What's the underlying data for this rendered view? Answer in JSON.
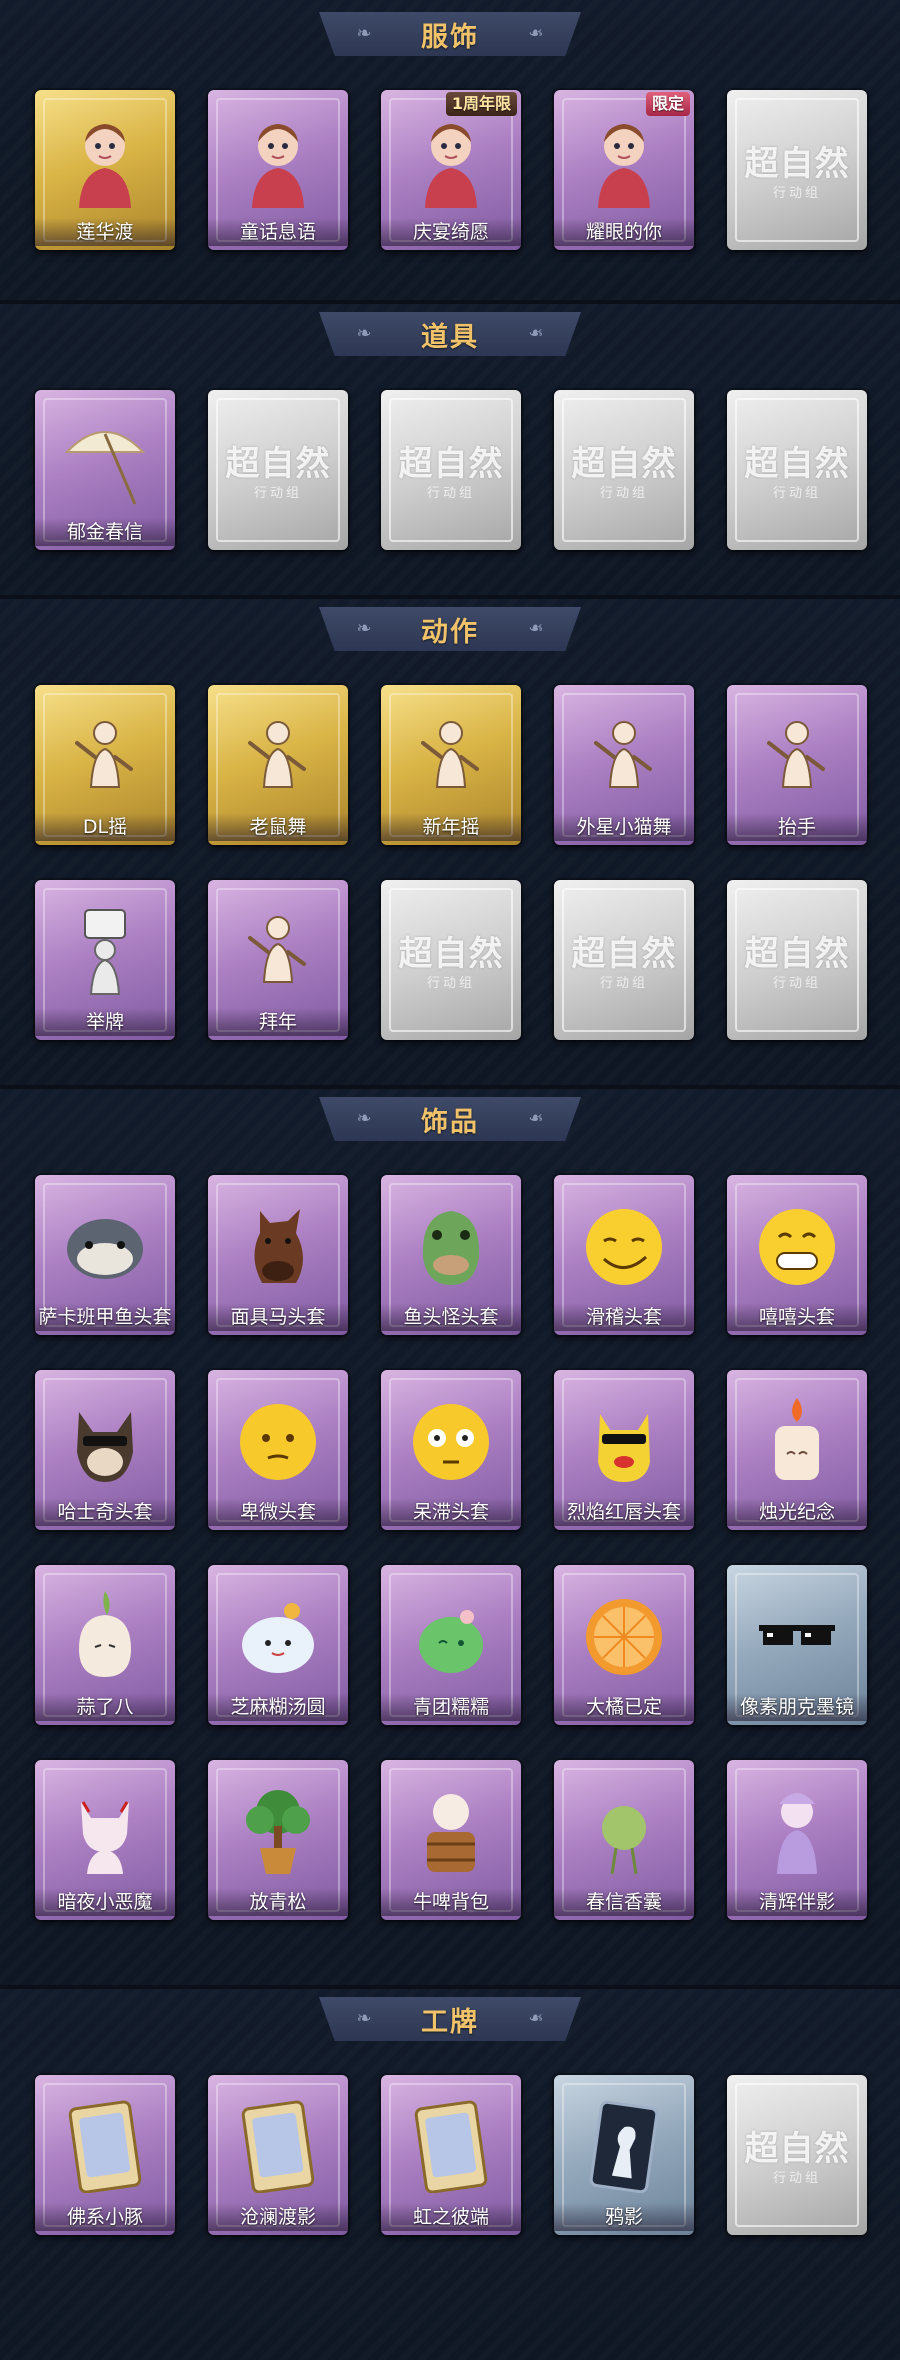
{
  "sections": [
    {
      "title": "服饰",
      "cards": [
        {
          "label": "莲华渡",
          "style": "gold",
          "icon": "costume-icon",
          "badge": "",
          "badge_style": ""
        },
        {
          "label": "童话息语",
          "style": "purple",
          "icon": "costume-icon",
          "badge": "",
          "badge_style": ""
        },
        {
          "label": "庆宴绮愿",
          "style": "purple",
          "icon": "costume-icon",
          "badge": "1周年限",
          "badge_style": "dark"
        },
        {
          "label": "耀眼的你",
          "style": "purple",
          "icon": "costume-icon",
          "badge": "限定",
          "badge_style": "red"
        },
        {
          "label": "",
          "style": "empty",
          "icon": "",
          "badge": "",
          "badge_style": ""
        }
      ]
    },
    {
      "title": "道具",
      "cards": [
        {
          "label": "郁金春信",
          "style": "purple",
          "icon": "umbrella-icon",
          "badge": "",
          "badge_style": ""
        },
        {
          "label": "",
          "style": "empty",
          "icon": "",
          "badge": "",
          "badge_style": ""
        },
        {
          "label": "",
          "style": "empty",
          "icon": "",
          "badge": "",
          "badge_style": ""
        },
        {
          "label": "",
          "style": "empty",
          "icon": "",
          "badge": "",
          "badge_style": ""
        },
        {
          "label": "",
          "style": "empty",
          "icon": "",
          "badge": "",
          "badge_style": ""
        }
      ]
    },
    {
      "title": "动作",
      "cards": [
        {
          "label": "DL摇",
          "style": "gold",
          "icon": "dance-figure-icon",
          "badge": "",
          "badge_style": ""
        },
        {
          "label": "老鼠舞",
          "style": "gold",
          "icon": "dance-figure-icon",
          "badge": "",
          "badge_style": ""
        },
        {
          "label": "新年摇",
          "style": "gold",
          "icon": "dance-figure-icon",
          "badge": "",
          "badge_style": ""
        },
        {
          "label": "外星小猫舞",
          "style": "purple",
          "icon": "dance-figure-icon",
          "badge": "",
          "badge_style": ""
        },
        {
          "label": "抬手",
          "style": "purple",
          "icon": "dance-figure-icon",
          "badge": "",
          "badge_style": ""
        },
        {
          "label": "举牌",
          "style": "purple",
          "icon": "sign-figure-icon",
          "badge": "",
          "badge_style": ""
        },
        {
          "label": "拜年",
          "style": "purple",
          "icon": "dance-figure-icon",
          "badge": "",
          "badge_style": ""
        },
        {
          "label": "",
          "style": "empty",
          "icon": "",
          "badge": "",
          "badge_style": ""
        },
        {
          "label": "",
          "style": "empty",
          "icon": "",
          "badge": "",
          "badge_style": ""
        },
        {
          "label": "",
          "style": "empty",
          "icon": "",
          "badge": "",
          "badge_style": ""
        }
      ]
    },
    {
      "title": "饰品",
      "cards": [
        {
          "label": "萨卡班甲鱼头套",
          "style": "purple",
          "icon": "fish-head-icon",
          "badge": "",
          "badge_style": ""
        },
        {
          "label": "面具马头套",
          "style": "purple",
          "icon": "horse-head-icon",
          "badge": "",
          "badge_style": ""
        },
        {
          "label": "鱼头怪头套",
          "style": "purple",
          "icon": "fish-monster-icon",
          "badge": "",
          "badge_style": ""
        },
        {
          "label": "滑稽头套",
          "style": "purple",
          "icon": "smirk-face-icon",
          "badge": "",
          "badge_style": ""
        },
        {
          "label": "嘻嘻头套",
          "style": "purple",
          "icon": "grin-face-icon",
          "badge": "",
          "badge_style": ""
        },
        {
          "label": "哈士奇头套",
          "style": "purple",
          "icon": "husky-head-icon",
          "badge": "",
          "badge_style": ""
        },
        {
          "label": "卑微头套",
          "style": "purple",
          "icon": "humble-face-icon",
          "badge": "",
          "badge_style": ""
        },
        {
          "label": "呆滞头套",
          "style": "purple",
          "icon": "stunned-face-icon",
          "badge": "",
          "badge_style": ""
        },
        {
          "label": "烈焰红唇头套",
          "style": "purple",
          "icon": "yellow-mascot-icon",
          "badge": "",
          "badge_style": ""
        },
        {
          "label": "烛光纪念",
          "style": "purple",
          "icon": "candle-icon",
          "badge": "",
          "badge_style": ""
        },
        {
          "label": "蒜了八",
          "style": "purple",
          "icon": "garlic-icon",
          "badge": "",
          "badge_style": ""
        },
        {
          "label": "芝麻糊汤圆",
          "style": "purple",
          "icon": "dumpling-icon",
          "badge": "",
          "badge_style": ""
        },
        {
          "label": "青团糯糯",
          "style": "purple",
          "icon": "green-rice-ball-icon",
          "badge": "",
          "badge_style": ""
        },
        {
          "label": "大橘已定",
          "style": "purple",
          "icon": "orange-slice-icon",
          "badge": "",
          "badge_style": ""
        },
        {
          "label": "像素朋克墨镜",
          "style": "blue",
          "icon": "pixel-sunglasses-icon",
          "badge": "",
          "badge_style": ""
        },
        {
          "label": "暗夜小恶魔",
          "style": "purple",
          "icon": "devil-icon",
          "badge": "",
          "badge_style": ""
        },
        {
          "label": "放青松",
          "style": "purple",
          "icon": "bonsai-icon",
          "badge": "",
          "badge_style": ""
        },
        {
          "label": "牛啤背包",
          "style": "purple",
          "icon": "cow-barrel-icon",
          "badge": "",
          "badge_style": ""
        },
        {
          "label": "春信香囊",
          "style": "purple",
          "icon": "sachet-icon",
          "badge": "",
          "badge_style": ""
        },
        {
          "label": "清辉伴影",
          "style": "purple",
          "icon": "companion-figure-icon",
          "badge": "",
          "badge_style": ""
        }
      ]
    },
    {
      "title": "工牌",
      "cards": [
        {
          "label": "佛系小豚",
          "style": "purple",
          "icon": "badge-card-icon",
          "badge": "",
          "badge_style": ""
        },
        {
          "label": "沧澜渡影",
          "style": "purple",
          "icon": "badge-card-icon",
          "badge": "",
          "badge_style": ""
        },
        {
          "label": "虹之彼端",
          "style": "purple",
          "icon": "badge-card-icon",
          "badge": "",
          "badge_style": ""
        },
        {
          "label": "鸦影",
          "style": "blue",
          "icon": "silhouette-card-icon",
          "badge": "",
          "badge_style": ""
        },
        {
          "label": "",
          "style": "empty",
          "icon": "",
          "badge": "",
          "badge_style": ""
        }
      ]
    }
  ],
  "placeholder": {
    "title": "超自然",
    "subtitle": "行动组"
  },
  "colors": {
    "bg": "#121a28",
    "banner": "#34405c",
    "title": "#f0c26a",
    "purple": "#ac80c3",
    "gold": "#d9b446",
    "blue": "#96aabd",
    "empty": "#cfcfcf"
  }
}
